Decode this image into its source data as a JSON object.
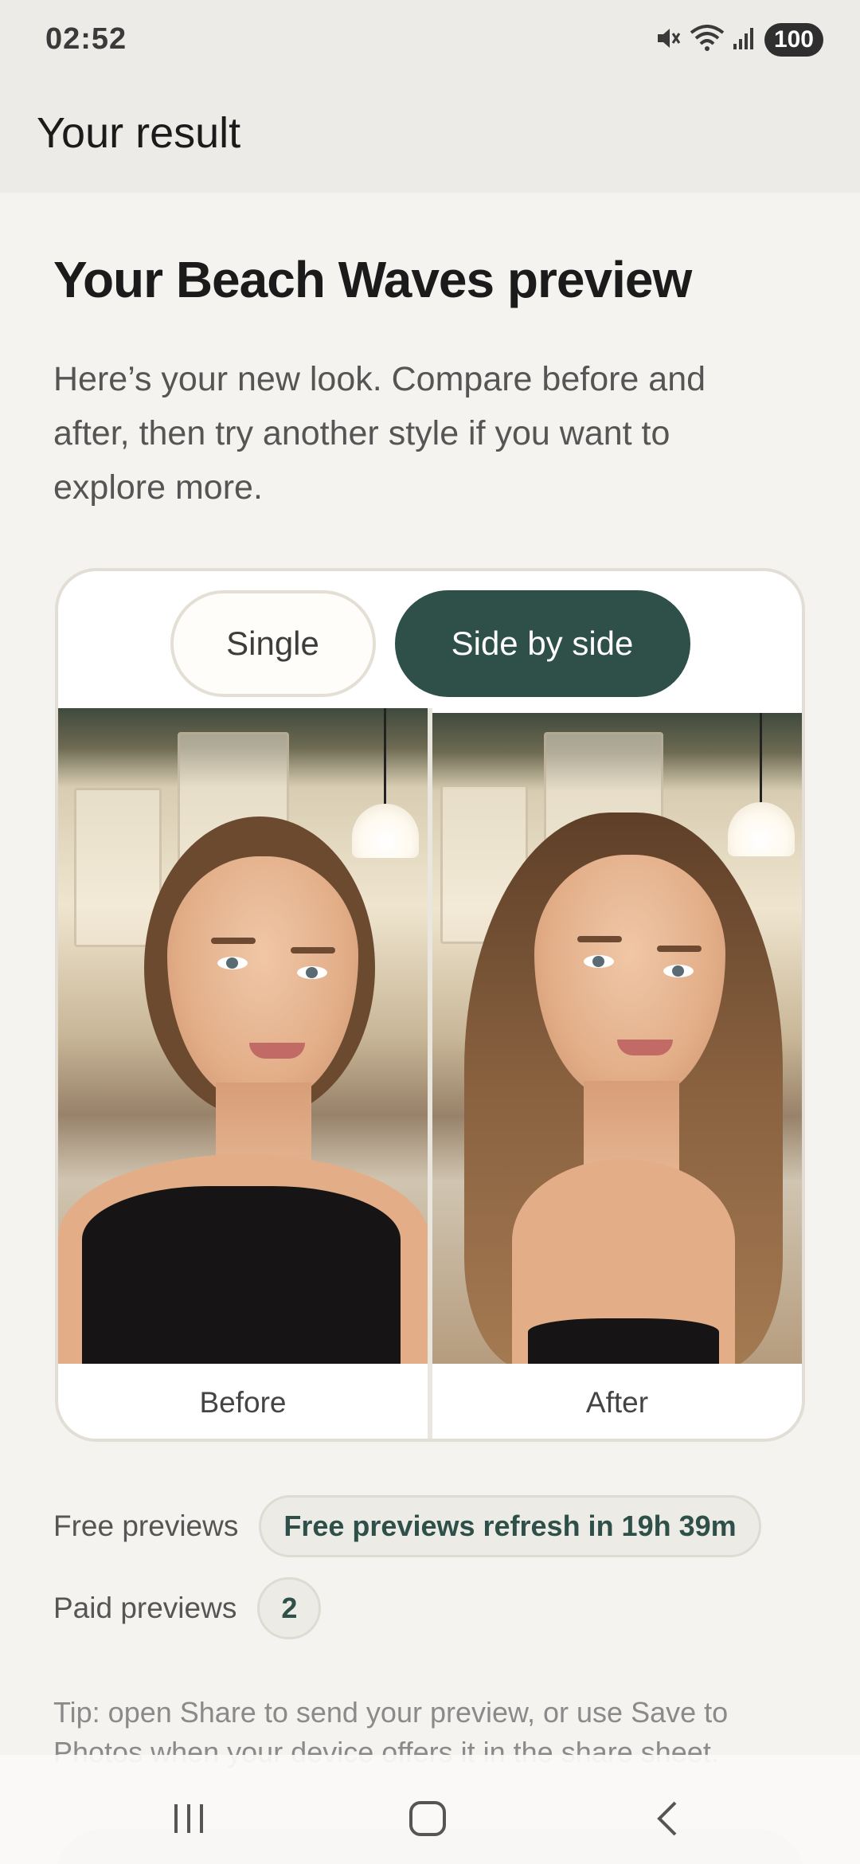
{
  "status_bar": {
    "time": "02:52",
    "battery": "100",
    "icons": [
      "mute-icon",
      "wifi-icon",
      "signal-icon",
      "battery-icon"
    ]
  },
  "app_bar": {
    "title": "Your result"
  },
  "result": {
    "headline": "Your Beach Waves preview",
    "intro": "Here’s your new look. Compare before and after, then try another style if you want to explore more."
  },
  "compare": {
    "modes": [
      {
        "label": "Single",
        "selected": false
      },
      {
        "label": "Side by side",
        "selected": true
      }
    ],
    "before_caption": "Before",
    "after_caption": "After"
  },
  "stats": {
    "free_label": "Free previews",
    "free_value": "Free previews refresh in 19h 39m",
    "paid_label": "Paid previews",
    "paid_value": "2"
  },
  "tip": "Tip: open Share to send your preview, or use Save to Photos when your device offers it in the share sheet.",
  "colors": {
    "accent": "#2e5049",
    "background": "#f4f3f0",
    "app_bar": "#ecebe7"
  }
}
